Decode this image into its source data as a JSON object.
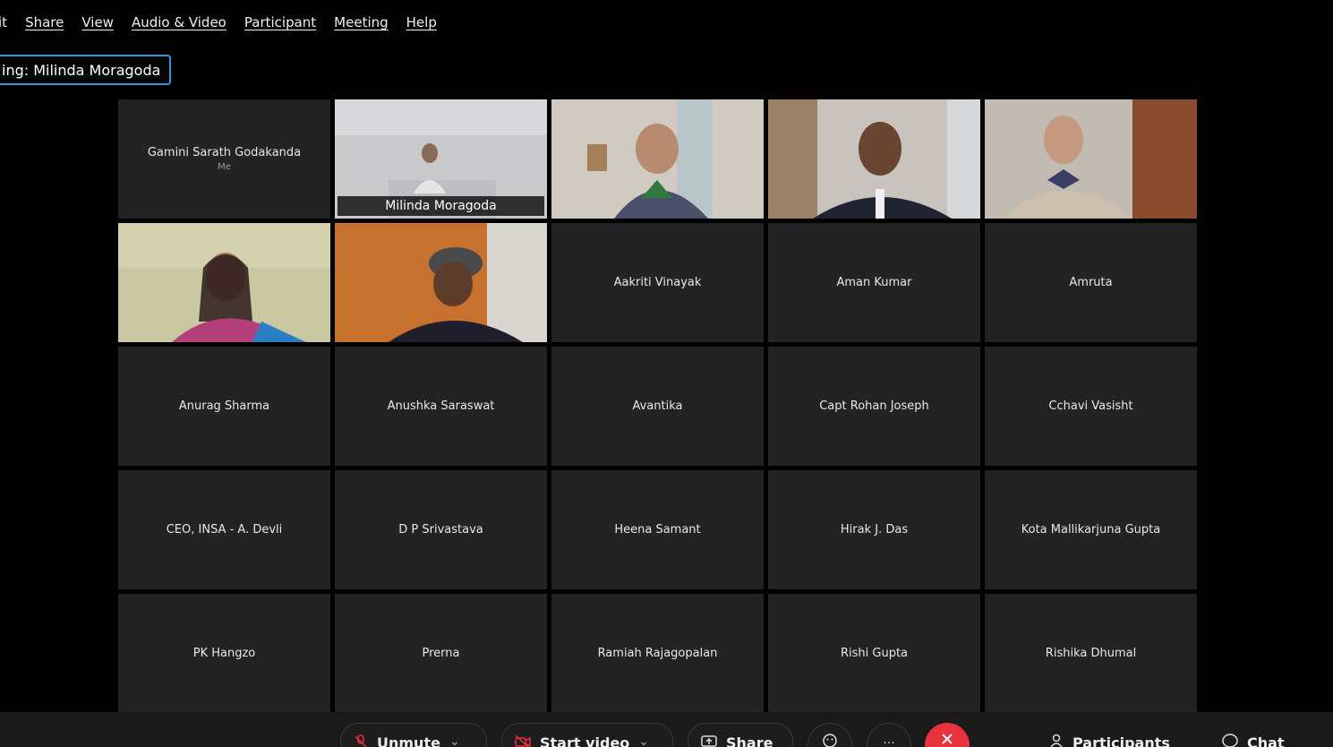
{
  "menu": {
    "items": [
      "it",
      "Share",
      "View",
      "Audio & Video",
      "Participant",
      "Meeting",
      "Help"
    ]
  },
  "speaking": {
    "label": "ing: Milinda Moragoda"
  },
  "grid": {
    "tiles": [
      {
        "name": "Gamini Sarath Godakanda",
        "sub": "Me",
        "video": false
      },
      {
        "name": "Milinda Moragoda",
        "video": true,
        "active": true
      },
      {
        "name": "",
        "video": true
      },
      {
        "name": "",
        "video": true
      },
      {
        "name": "",
        "video": true
      },
      {
        "name": "",
        "video": true
      },
      {
        "name": "",
        "video": true
      },
      {
        "name": "Aakriti Vinayak",
        "video": false
      },
      {
        "name": "Aman Kumar",
        "video": false
      },
      {
        "name": "Amruta",
        "video": false
      },
      {
        "name": "Anurag Sharma",
        "video": false
      },
      {
        "name": "Anushka Saraswat",
        "video": false
      },
      {
        "name": "Avantika",
        "video": false
      },
      {
        "name": "Capt Rohan Joseph",
        "video": false
      },
      {
        "name": "Cchavi Vasisht",
        "video": false
      },
      {
        "name": "CEO, INSA - A. Devli",
        "video": false
      },
      {
        "name": "D P Srivastava",
        "video": false
      },
      {
        "name": "Heena Samant",
        "video": false
      },
      {
        "name": "Hirak J. Das",
        "video": false
      },
      {
        "name": "Kota Mallikarjuna Gupta",
        "video": false
      },
      {
        "name": "PK Hangzo",
        "video": false
      },
      {
        "name": "Prerna",
        "video": false
      },
      {
        "name": "Ramiah Rajagopalan",
        "video": false
      },
      {
        "name": "Rishi Gupta",
        "video": false
      },
      {
        "name": "Rishika Dhumal",
        "video": false
      }
    ]
  },
  "controls": {
    "unmute": "Unmute",
    "start_video": "Start video",
    "share": "Share",
    "participants": "Participants",
    "chat": "Chat",
    "more": "...",
    "leave_icon": "close-icon",
    "chevron": "⌄"
  },
  "colors": {
    "accent": "#1fa0e8",
    "leave": "#e8323c",
    "tile": "#232323"
  }
}
